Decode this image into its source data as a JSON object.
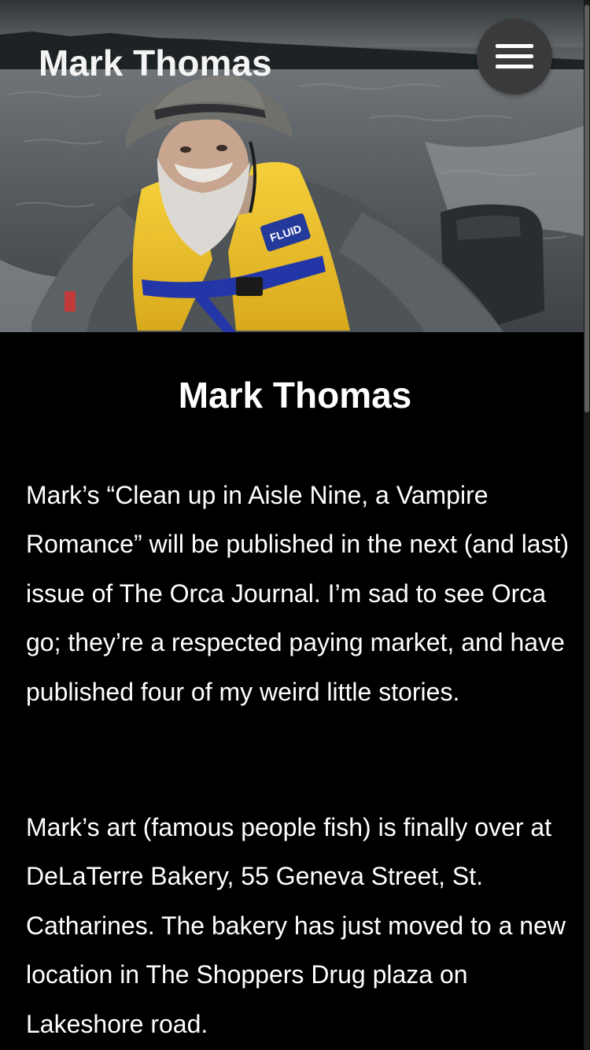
{
  "header": {
    "site_title": "Mark Thomas",
    "menu_icon": "hamburger-menu-icon",
    "hero_image_label": "photo of bearded man in yellow FLUID life jacket in a boat on a lake"
  },
  "hero_badge_text": "FLUID",
  "main": {
    "heading": "Mark Thomas",
    "paragraphs": [
      "Mark’s “Clean up in Aisle Nine, a Vampire Romance” will be published in the next (and last) issue of The Orca Journal. I’m sad to see Orca go; they’re a respected paying market, and have published four of my weird little stories.",
      "Mark’s art (famous people fish) is finally over at DeLaTerre Bakery, 55 Geneva Street, St. Catharines. The bakery has just moved to a new location in The Shoppers Drug plaza on Lakeshore road."
    ]
  },
  "colors": {
    "background": "#000000",
    "text": "#ffffff",
    "menu_button": "#3a3a3a",
    "life_jacket": "#f2c531",
    "strap_blue": "#2336a8"
  }
}
